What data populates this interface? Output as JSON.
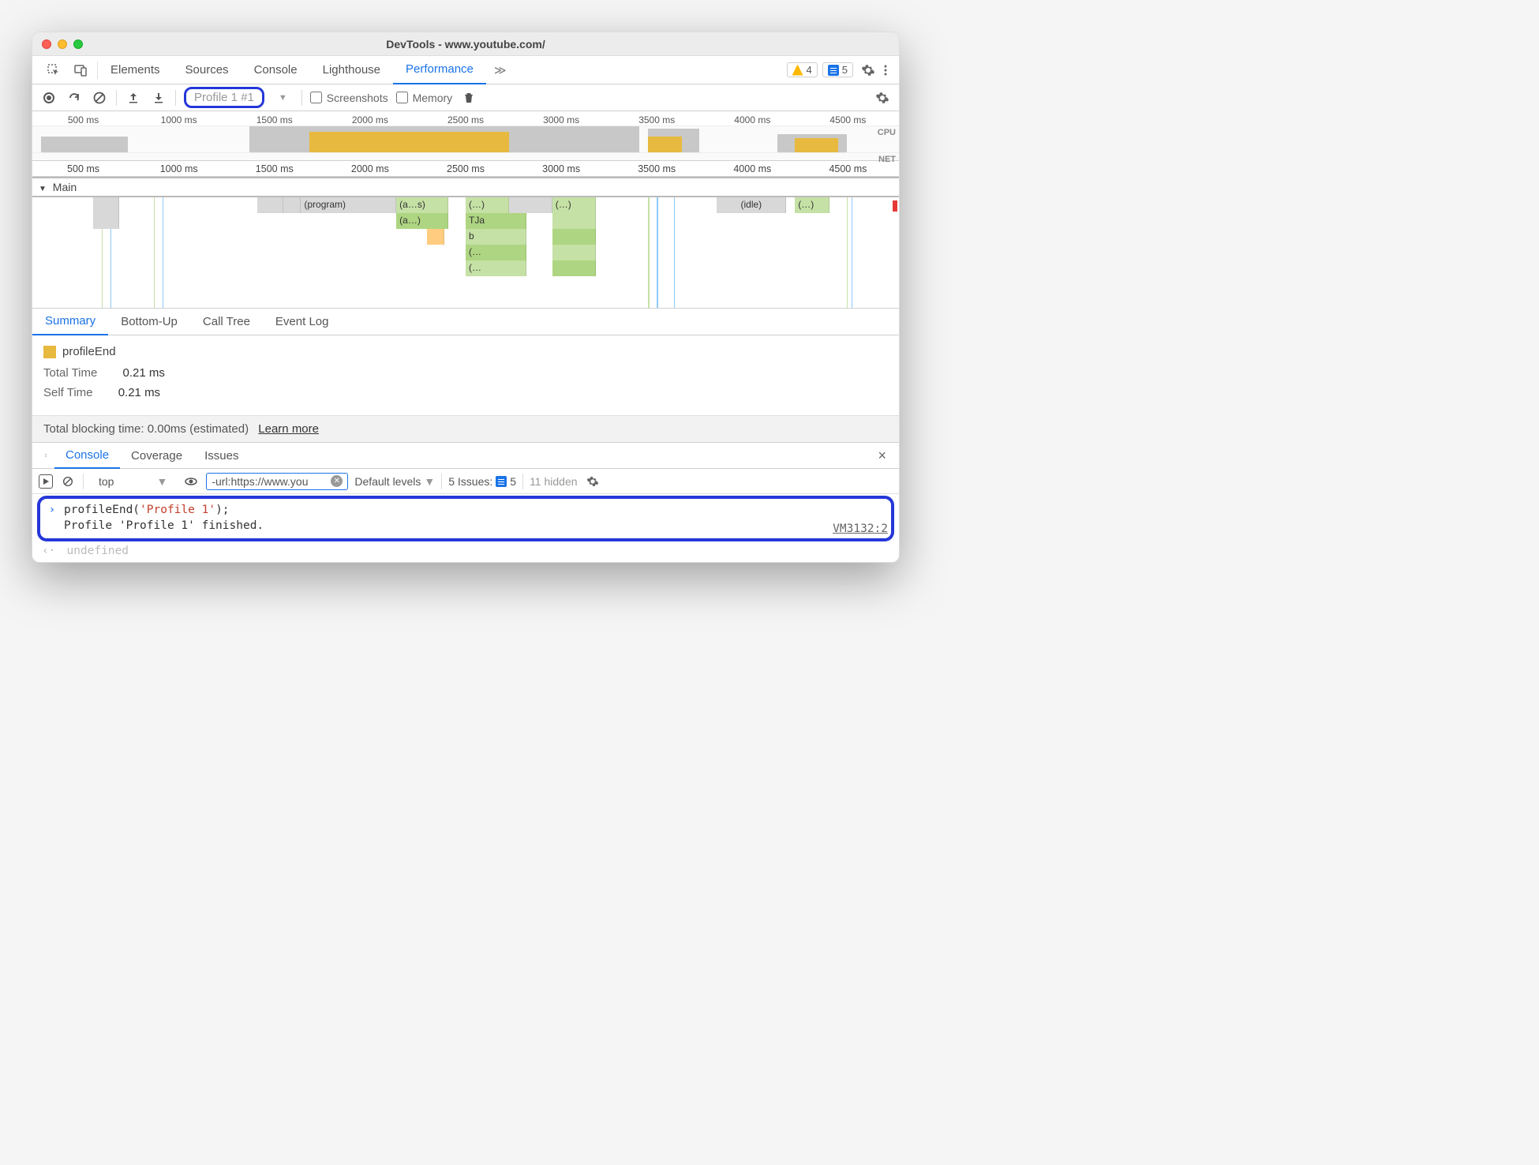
{
  "window": {
    "title": "DevTools - www.youtube.com/"
  },
  "main_tabs": {
    "items": [
      "Elements",
      "Sources",
      "Console",
      "Lighthouse",
      "Performance"
    ],
    "active": "Performance",
    "overflow": "≫",
    "warning_count": "4",
    "message_count": "5"
  },
  "perf_toolbar": {
    "profile_name": "Profile 1 #1",
    "screenshots_label": "Screenshots",
    "memory_label": "Memory"
  },
  "ruler": {
    "ticks": [
      "500 ms",
      "1000 ms",
      "1500 ms",
      "2000 ms",
      "2500 ms",
      "3000 ms",
      "3500 ms",
      "4000 ms",
      "4500 ms"
    ]
  },
  "overview_labels": {
    "cpu": "CPU",
    "net": "NET"
  },
  "main_track": {
    "title": "Main",
    "bars": {
      "program": "(program)",
      "as": "(a…s)",
      "paren": "(…)",
      "paren2": "(…)",
      "idle": "(idle)",
      "paren3": "(…)",
      "a2": "(a…)",
      "tja": "TJa",
      "b": "b",
      "p1": "(…",
      "p2": "(…"
    }
  },
  "sub_tabs": {
    "items": [
      "Summary",
      "Bottom-Up",
      "Call Tree",
      "Event Log"
    ],
    "active": "Summary"
  },
  "summary": {
    "event_name": "profileEnd",
    "total_label": "Total Time",
    "total_value": "0.21 ms",
    "self_label": "Self Time",
    "self_value": "0.21 ms",
    "blocking_text": "Total blocking time: 0.00ms (estimated)",
    "learn_more": "Learn more"
  },
  "drawer_tabs": {
    "items": [
      "Console",
      "Coverage",
      "Issues"
    ],
    "active": "Console"
  },
  "console_toolbar": {
    "context": "top",
    "filter": "-url:https://www.you",
    "levels": "Default levels",
    "issues_label": "5 Issues:",
    "issues_count": "5",
    "hidden": "11 hidden"
  },
  "console": {
    "input_fn": "profileEnd(",
    "input_arg": "'Profile 1'",
    "input_end": ");",
    "output": "Profile 'Profile 1' finished.",
    "undefined": "undefined",
    "vm_link": "VM3132:2"
  }
}
